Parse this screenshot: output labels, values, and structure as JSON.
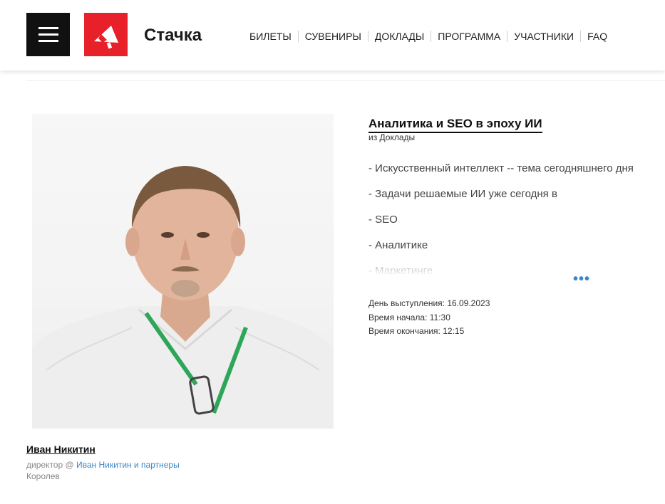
{
  "header": {
    "brand": "Стачка",
    "nav": [
      "БИЛЕТЫ",
      "СУВЕНИРЫ",
      "ДОКЛАДЫ",
      "ПРОГРАММА",
      "УЧАСТНИКИ",
      "FAQ"
    ]
  },
  "colors": {
    "logo_red": "#e8202a",
    "link_blue": "#3a86c8",
    "burger_bg": "#111111"
  },
  "icons": {
    "menu": "hamburger-icon",
    "logo": "megaphone-icon",
    "more": "more-dots-icon"
  },
  "speaker": {
    "name": "Иван Никитин",
    "role_prefix": "директор @ ",
    "company": "Иван Никитин и партнеры",
    "city": "Королев"
  },
  "talk": {
    "title": "Аналитика и SEO в эпоху ИИ",
    "source": "из Доклады",
    "description": [
      "- Искусственный интеллект -- тема сегодняшнего дня",
      "- Задачи решаемые ИИ уже сегодня в",
      "- SEO",
      "- Аналитике",
      "- Маркетинге"
    ],
    "more": "•••",
    "day": "День выступления: 16.09.2023",
    "start": "Время начала: 11:30",
    "end": "Время окончания: 12:15"
  }
}
